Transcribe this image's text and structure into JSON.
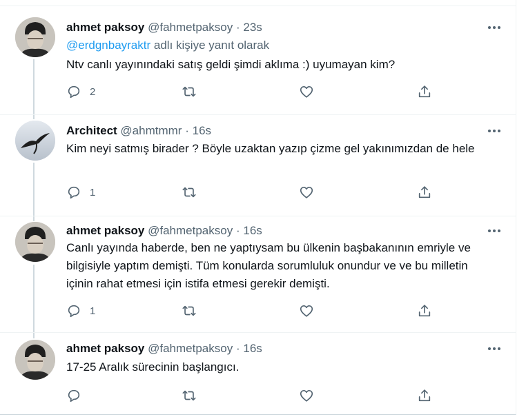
{
  "tweets": [
    {
      "name": "ahmet paksoy",
      "handle": "@fahmetpaksoy",
      "separator": "·",
      "time": "23s",
      "reply_to_mention": "@erdgnbayraktr",
      "reply_to_suffix": " adlı kişiye yanıt olarak",
      "text": "Ntv canlı yayınındaki satış geldi şimdi aklıma :) uyumayan kim?",
      "reply_count": "2",
      "avatar_icon": "portrait-avatar-icon"
    },
    {
      "name": "Architect",
      "handle": "@ahmtmmr",
      "separator": "·",
      "time": "16s",
      "text": "Kim neyi satmış birader ? Böyle uzaktan yazıp çizme gel yakınımızdan de hele",
      "reply_count": "1",
      "avatar_icon": "bird-avatar-icon"
    },
    {
      "name": "ahmet paksoy",
      "handle": "@fahmetpaksoy",
      "separator": "·",
      "time": "16s",
      "text": "Canlı yayında haberde, ben ne yaptıysam bu ülkenin başbakanının emriyle ve bilgisiyle yaptım demişti. Tüm konularda sorumluluk onundur ve ve bu milletin içinin rahat etmesi için istifa etmesi gerekir demişti.",
      "reply_count": "1",
      "avatar_icon": "portrait-avatar-icon"
    },
    {
      "name": "ahmet paksoy",
      "handle": "@fahmetpaksoy",
      "separator": "·",
      "time": "16s",
      "text": "17-25 Aralık sürecinin başlangıcı.",
      "reply_count": "",
      "avatar_icon": "portrait-avatar-icon"
    }
  ],
  "colors": {
    "text_primary": "#0f1419",
    "text_secondary": "#536471",
    "link": "#1d9bf0",
    "border": "#eff3f4",
    "thread_line": "#cfd9de"
  }
}
